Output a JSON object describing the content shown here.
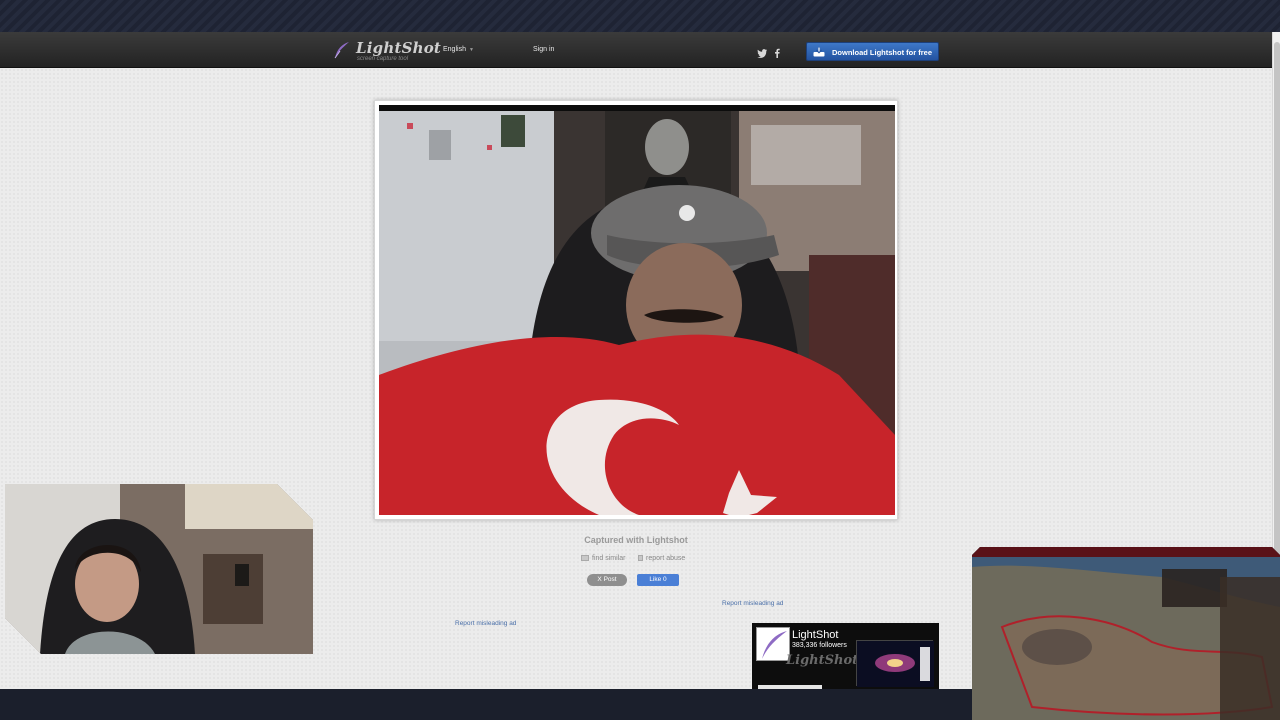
{
  "header": {
    "brand": "LightShot",
    "tagline": "screen capture tool",
    "language": "English",
    "signin_label": "Sign in",
    "download_label": "Download Lightshot for free",
    "social": [
      "twitter-icon",
      "facebook-icon"
    ]
  },
  "main": {
    "caption": "Captured with Lightshot",
    "find_similar_label": "find similar",
    "report_abuse_label": "report abuse",
    "x_post_label": "X Post",
    "fb_like_label": "Like 0",
    "report_ad_label_right": "Report misleading ad",
    "report_ad_label_left": "Report misleading ad"
  },
  "fb_widget": {
    "name": "LightShot",
    "followers": "383,336 followers",
    "watermark": "LightShot"
  },
  "colors": {
    "accent_button": "#2f67b8",
    "header_bg": "#2b2b2b",
    "page_bg": "#ececec",
    "link": "#4a6fa8"
  }
}
